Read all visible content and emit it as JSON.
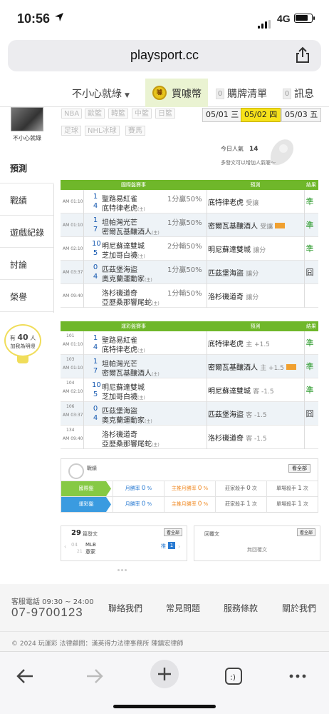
{
  "status": {
    "time": "10:56",
    "network": "4G"
  },
  "browser": {
    "url": "playsport.cc"
  },
  "topnav": {
    "user": "不小心就綠",
    "buy": "買噱幣",
    "coin": "噱",
    "cart": "購牌清單",
    "cart_count": "0",
    "msg": "訊息",
    "msg_count": "0"
  },
  "profile": {
    "name": "不小心就綠"
  },
  "sidebar": [
    {
      "label": "預測"
    },
    {
      "label": "戰績"
    },
    {
      "label": "遊戲紀錄"
    },
    {
      "label": "討論"
    },
    {
      "label": "榮譽"
    }
  ],
  "popularity": {
    "prefix": "有",
    "count": "40",
    "unit": "人",
    "line2": "加我為明燈"
  },
  "tags": [
    "NBA",
    "歐籃",
    "韓籃",
    "中籃",
    "日籃",
    "足球",
    "NHL冰球",
    "賽馬"
  ],
  "dates": [
    "05/01 三",
    "05/02 四",
    "05/03 五"
  ],
  "visits": {
    "label": "今日人氣",
    "value": "14",
    "note": "多發文可以增加人氣喔～"
  },
  "intl": {
    "header": [
      "國際盤賽事",
      "預測",
      "結果"
    ],
    "rows": [
      {
        "time": "AM 01:10",
        "s1": "1",
        "t1": "聖路易紅雀",
        "s2": "4",
        "t2": "底特律老虎",
        "tag2": "(主)",
        "odds": "1分贏50%",
        "pick": "底特律老虎",
        "ptype": "受讓",
        "badge": false,
        "result": "準"
      },
      {
        "time": "AM 01:10",
        "s1": "1",
        "t1": "坦帕灣光芒",
        "s2": "7",
        "t2": "密爾瓦基釀酒人",
        "tag2": "(主)",
        "odds": "1分贏50%",
        "pick": "密爾瓦基釀酒人",
        "ptype": "受讓",
        "badge": true,
        "result": "準"
      },
      {
        "time": "AM 02:10",
        "s1": "10",
        "t1": "明尼蘇達雙城",
        "s2": "5",
        "t2": "芝加哥白襪",
        "tag2": "(主)",
        "odds": "2分輸50%",
        "pick": "明尼蘇達雙城",
        "ptype": "讓分",
        "badge": false,
        "result": "準"
      },
      {
        "time": "AM 03:37",
        "s1": "0",
        "t1": "匹茲堡海盜",
        "s2": "4",
        "t2": "奧克蘭運動家",
        "tag2": "(主)",
        "odds": "1分贏50%",
        "pick": "匹茲堡海盜",
        "ptype": "讓分",
        "badge": false,
        "result": "囧"
      },
      {
        "time": "AM 09:40",
        "s1": "",
        "t1": "洛杉磯道奇",
        "s2": "",
        "t2": "亞歷桑那響尾蛇",
        "tag2": "(主)",
        "odds": "1分輸50%",
        "pick": "洛杉磯道奇",
        "ptype": "讓分",
        "badge": false,
        "result": ""
      }
    ]
  },
  "lottery": {
    "header": [
      "運彩盤賽事",
      "預測",
      "結果"
    ],
    "rows": [
      {
        "id": "101",
        "time": "AM 01:10",
        "s1": "1",
        "t1": "聖路易紅雀",
        "s2": "4",
        "t2": "底特律老虎",
        "tag2": "(主)",
        "pick": "底特律老虎",
        "ptype": "主 +1.5",
        "badge": false,
        "result": "準"
      },
      {
        "id": "103",
        "time": "AM 01:10",
        "s1": "1",
        "t1": "坦帕灣光芒",
        "s2": "7",
        "t2": "密爾瓦基釀酒人",
        "tag2": "(主)",
        "pick": "密爾瓦基釀酒人",
        "ptype": "主 +1.5",
        "badge": true,
        "result": "準"
      },
      {
        "id": "104",
        "time": "AM 02:10",
        "s1": "10",
        "t1": "明尼蘇達雙城",
        "s2": "5",
        "t2": "芝加哥白襪",
        "tag2": "(主)",
        "pick": "明尼蘇達雙城",
        "ptype": "客 -1.5",
        "badge": false,
        "result": "準"
      },
      {
        "id": "106",
        "time": "AM 03:37",
        "s1": "0",
        "t1": "匹茲堡海盜",
        "s2": "4",
        "t2": "奧克蘭運動家",
        "tag2": "(主)",
        "pick": "匹茲堡海盜",
        "ptype": "客 -1.5",
        "badge": false,
        "result": "囧"
      },
      {
        "id": "134",
        "time": "AM 09:40",
        "s1": "",
        "t1": "洛杉磯道奇",
        "s2": "",
        "t2": "亞歷桑那響尾蛇",
        "tag2": "(主)",
        "pick": "洛杉磯道奇",
        "ptype": "客 -1.5",
        "badge": false,
        "result": ""
      }
    ]
  },
  "record": {
    "title": "戰績",
    "all": "看全部",
    "rows": [
      {
        "label": "國際盤",
        "c1": "月勝率",
        "v1": "0",
        "u1": "%",
        "c2": "主推月勝率",
        "v2": "0",
        "u2": "%",
        "c3": "莊家殺手",
        "v3": "0",
        "u3": "次",
        "c4": "單場殺手",
        "v4": "1",
        "u4": "次"
      },
      {
        "label": "運彩盤",
        "c1": "月勝率",
        "v1": "0",
        "u1": "%",
        "c2": "主推月勝率",
        "v2": "0",
        "u2": "%",
        "c3": "莊家殺手",
        "v3": "1",
        "u3": "次",
        "c4": "單場殺手",
        "v4": "1",
        "u4": "次"
      }
    ]
  },
  "posts": {
    "count": "29",
    "label": "篇發文",
    "more": "看全部",
    "date_m": "04",
    "date_d": "21",
    "league": "MLB",
    "title": "意家",
    "push_lbl": "推",
    "push_count": "1"
  },
  "replies": {
    "label": "回覆文",
    "more": "看全部",
    "empty": "無回覆文"
  },
  "footer": {
    "tel_label": "客服電話 09:30 ~ 24:00",
    "tel": "07-9700123",
    "links": [
      "聯絡我們",
      "常見問題",
      "服務條款",
      "關於我們"
    ],
    "copyright": "© 2024 玩運彩 法律顧問：漢英得力法律事務所 陳鎮宏律師"
  },
  "colors": {
    "green": "#6fb72a",
    "yellow": "#f6e21a",
    "blue": "#1558b0",
    "win": "#2b9a2b"
  }
}
